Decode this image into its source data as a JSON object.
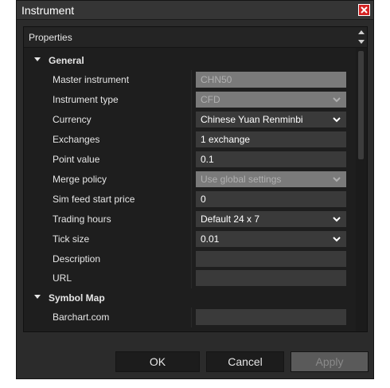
{
  "window": {
    "title": "Instrument"
  },
  "panel": {
    "title": "Properties"
  },
  "sections": {
    "general": {
      "label": "General",
      "rows": [
        {
          "label": "Master instrument",
          "value": "CHN50",
          "state": "disabled",
          "dropdown": false
        },
        {
          "label": "Instrument type",
          "value": "CFD",
          "state": "disabled",
          "dropdown": true
        },
        {
          "label": "Currency",
          "value": "Chinese Yuan Renminbi",
          "state": "enabled",
          "dropdown": true
        },
        {
          "label": "Exchanges",
          "value": "1 exchange",
          "state": "enabled",
          "dropdown": false
        },
        {
          "label": "Point value",
          "value": "0.1",
          "state": "enabled",
          "dropdown": false
        },
        {
          "label": "Merge policy",
          "value": "Use global settings",
          "state": "disabled",
          "dropdown": true
        },
        {
          "label": "Sim feed start price",
          "value": "0",
          "state": "enabled",
          "dropdown": false
        },
        {
          "label": "Trading hours",
          "value": "Default 24 x 7",
          "state": "enabled",
          "dropdown": true
        },
        {
          "label": "Tick size",
          "value": "0.01",
          "state": "enabled",
          "dropdown": true
        },
        {
          "label": "Description",
          "value": "",
          "state": "enabled",
          "dropdown": false
        },
        {
          "label": "URL",
          "value": "",
          "state": "enabled",
          "dropdown": false
        }
      ]
    },
    "symbol_map": {
      "label": "Symbol Map",
      "rows": [
        {
          "label": "Barchart.com",
          "value": "",
          "state": "enabled",
          "dropdown": false
        }
      ]
    }
  },
  "buttons": {
    "ok": "OK",
    "cancel": "Cancel",
    "apply": "Apply"
  },
  "colors": {
    "background": "#2b2b2b",
    "panel": "#1e1e1e",
    "field": "#3a3a3a",
    "field_disabled": "#7a7a7a",
    "close": "#d42323"
  },
  "icons": [
    "close-icon",
    "collapse-arrow-icon",
    "chevron-down-icon",
    "scroll-up-icon",
    "scroll-down-icon"
  ]
}
